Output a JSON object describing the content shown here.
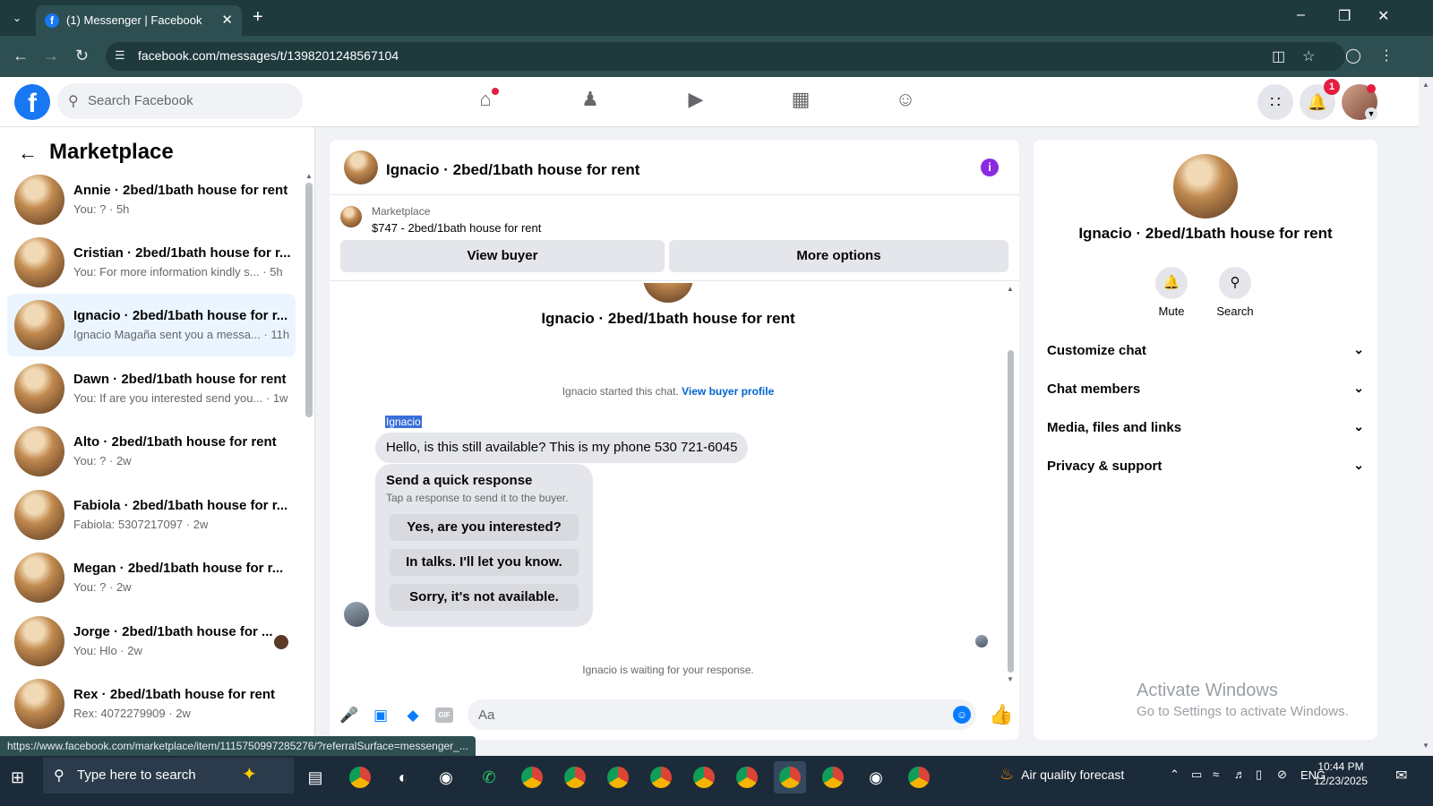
{
  "browser": {
    "tab_title": "(1) Messenger | Facebook",
    "url": "facebook.com/messages/t/1398201248567104",
    "status_url": "https://www.facebook.com/marketplace/item/1115750997285276/?referralSurface=messenger_..."
  },
  "header": {
    "search_placeholder": "Search Facebook",
    "notifications_count": "1"
  },
  "sidebar": {
    "title": "Marketplace",
    "conversations": [
      {
        "name": "Annie · 2bed/1bath house for rent",
        "preview": "You: ? · 5h",
        "active": false
      },
      {
        "name": "Cristian · 2bed/1bath house for r...",
        "preview": "You: For more information kindly s... · 5h",
        "active": false
      },
      {
        "name": "Ignacio · 2bed/1bath house for r...",
        "preview": "Ignacio Magaña sent you a messa... · 11h",
        "active": true
      },
      {
        "name": "Dawn · 2bed/1bath house for rent",
        "preview": "You: If are you interested send you... · 1w",
        "active": false
      },
      {
        "name": "Alto · 2bed/1bath house for rent",
        "preview": "You: ? · 2w",
        "active": false
      },
      {
        "name": "Fabiola · 2bed/1bath house for r...",
        "preview": "Fabiola: 5307217097 · 2w",
        "active": false
      },
      {
        "name": "Megan · 2bed/1bath house for r...",
        "preview": "You: ? · 2w",
        "active": false
      },
      {
        "name": "Jorge · 2bed/1bath house for ...",
        "preview": "You: Hlo · 2w",
        "active": false
      },
      {
        "name": "Rex · 2bed/1bath house for rent",
        "preview": "Rex: 4072279909 · 2w",
        "active": false
      }
    ]
  },
  "chat": {
    "title": "Ignacio · 2bed/1bath house for rent",
    "marketplace_label": "Marketplace",
    "listing": "$747 - 2bed/1bath house for rent",
    "view_buyer": "View buyer",
    "more_options": "More options",
    "started_text": "Ignacio started this chat.",
    "view_buyer_profile": "View buyer profile",
    "sender": "Ignacio",
    "message": "Hello, is this still available? This is my phone 530 721-6045",
    "quick_response": {
      "title": "Send a quick response",
      "subtitle": "Tap a response to send it to the buyer.",
      "options": [
        "Yes, are you interested?",
        "In talks. I'll let you know.",
        "Sorry, it's not available."
      ]
    },
    "waiting": "Ignacio is waiting for your response.",
    "composer_placeholder": "Aa",
    "gif_label": "GIF"
  },
  "details": {
    "name": "Ignacio · 2bed/1bath house for rent",
    "mute": "Mute",
    "search": "Search",
    "sections": [
      "Customize chat",
      "Chat members",
      "Media, files and links",
      "Privacy & support"
    ],
    "watermark_title": "Activate Windows",
    "watermark_sub": "Go to Settings to activate Windows."
  },
  "taskbar": {
    "search_placeholder": "Type here to search",
    "weather": "Air quality forecast",
    "lang": "ENG",
    "time": "10:44 PM",
    "date": "12/23/2025"
  }
}
